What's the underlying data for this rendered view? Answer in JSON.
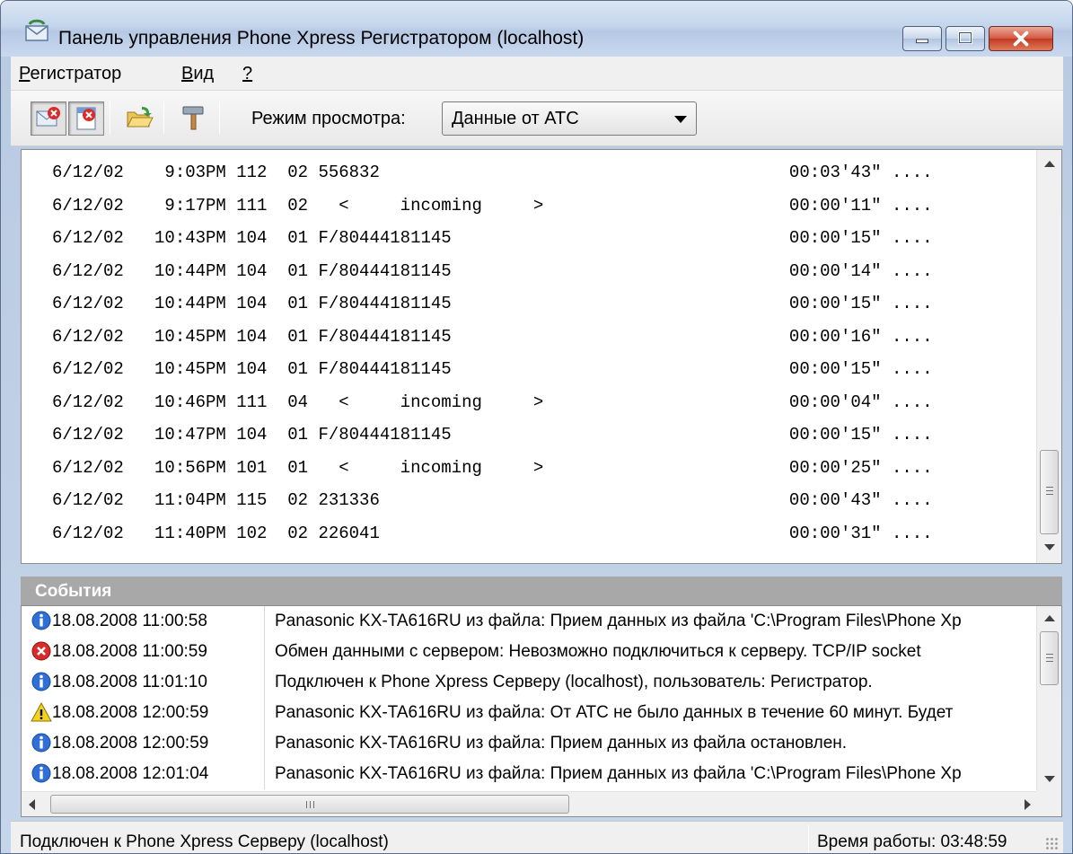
{
  "window": {
    "title": "Панель управления Phone Xpress Регистратором (localhost)"
  },
  "menu": {
    "registrar": {
      "prefix": "",
      "accel": "Р",
      "rest": "егистратор"
    },
    "view": {
      "prefix": "",
      "accel": "В",
      "rest": "ид"
    },
    "help": {
      "prefix": "",
      "accel": "?",
      "rest": ""
    }
  },
  "toolbar": {
    "view_mode_label": "Режим просмотра:",
    "view_mode_value": "Данные от АТС"
  },
  "log_lines": [
    "6/12/02    9:03PM 112  02 556832                                        00:03'43\" ....",
    "6/12/02    9:17PM 111  02   <     incoming     >                        00:00'11\" ....",
    "6/12/02   10:43PM 104  01 F/80444181145                                 00:00'15\" ....",
    "6/12/02   10:44PM 104  01 F/80444181145                                 00:00'14\" ....",
    "6/12/02   10:44PM 104  01 F/80444181145                                 00:00'15\" ....",
    "6/12/02   10:45PM 104  01 F/80444181145                                 00:00'16\" ....",
    "6/12/02   10:45PM 104  01 F/80444181145                                 00:00'15\" ....",
    "6/12/02   10:46PM 111  04   <     incoming     >                        00:00'04\" ....",
    "6/12/02   10:47PM 104  01 F/80444181145                                 00:00'15\" ....",
    "6/12/02   10:56PM 101  01   <     incoming     >                        00:00'25\" ....",
    "6/12/02   11:04PM 115  02 231336                                        00:00'43\" ....",
    "6/12/02   11:40PM 102  02 226041                                        00:00'31\" ...."
  ],
  "events": {
    "title": "События",
    "rows": [
      {
        "icon": "info-icon",
        "time": "18.08.2008 11:00:58",
        "message": "Panasonic KX-TA616RU из файла: Прием данных из файла 'C:\\Program Files\\Phone Xp"
      },
      {
        "icon": "error-icon",
        "time": "18.08.2008 11:00:59",
        "message": "Обмен данными с сервером: Невозможно подключиться к серверу.   TCP/IP socket"
      },
      {
        "icon": "info-icon",
        "time": "18.08.2008 11:01:10",
        "message": "Подключен к Phone Xpress Серверу (localhost), пользователь: Регистратор."
      },
      {
        "icon": "warning-icon",
        "time": "18.08.2008 12:00:59",
        "message": "Panasonic KX-TA616RU из файла: От АТС не было данных в течение 60 минут. Будет"
      },
      {
        "icon": "info-icon",
        "time": "18.08.2008 12:00:59",
        "message": "Panasonic KX-TA616RU из файла: Прием данных из файла остановлен."
      },
      {
        "icon": "info-icon",
        "time": "18.08.2008 12:01:04",
        "message": "Panasonic KX-TA616RU из файла: Прием данных из файла 'C:\\Program Files\\Phone Xp"
      }
    ]
  },
  "status": {
    "connection": "Подключен к Phone Xpress Серверу (localhost)",
    "uptime": "Время работы: 03:48:59"
  },
  "colors": {
    "events_header_bg": "#a8a8a8",
    "error": "#d92b2b",
    "info": "#2f6fd6",
    "warning": "#f2d21b"
  }
}
